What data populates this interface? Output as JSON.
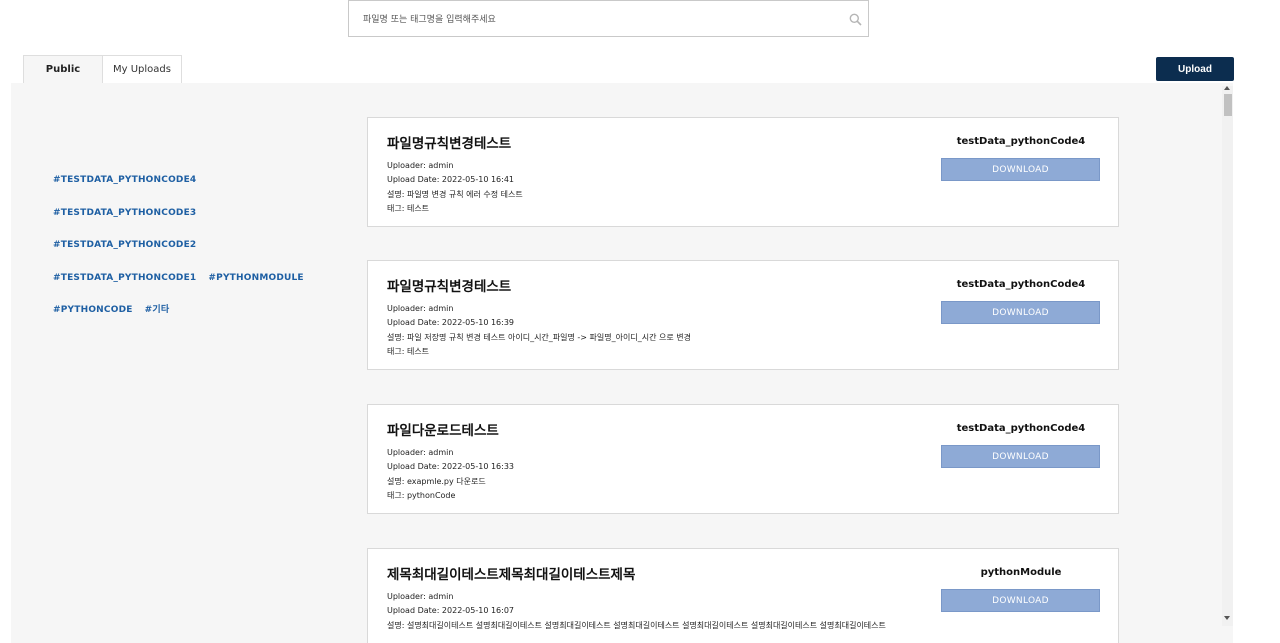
{
  "search": {
    "placeholder": "파일명 또는 태그명을 입력해주세요",
    "value": ""
  },
  "tabs": [
    {
      "label": "Public"
    },
    {
      "label": "My Uploads"
    }
  ],
  "upload_label": "Upload",
  "tag_lines": [
    [
      "#TESTDATA_PYTHONCODE4"
    ],
    [
      "#TESTDATA_PYTHONCODE3"
    ],
    [
      "#TESTDATA_PYTHONCODE2"
    ],
    [
      "#TESTDATA_PYTHONCODE1",
      "#PYTHONMODULE"
    ],
    [
      "#PYTHONCODE",
      "#기타"
    ]
  ],
  "cards": [
    {
      "title": "파일명규칙변경테스트",
      "uploader": "Uploader: admin",
      "date": "Upload Date: 2022-05-10 16:41",
      "desc": "설명: 파일명 변경 규칙 에러 수정 테스트",
      "tags": "태그: 테스트",
      "tag_name": "testData_pythonCode4",
      "download": "DOWNLOAD"
    },
    {
      "title": "파일명규칙변경테스트",
      "uploader": "Uploader: admin",
      "date": "Upload Date: 2022-05-10 16:39",
      "desc": "설명: 파일 저장명 규칙 변경 테스트 아이디_시간_파일명 -> 파일명_아이디_시간 으로 변경",
      "tags": "태그: 테스트",
      "tag_name": "testData_pythonCode4",
      "download": "DOWNLOAD"
    },
    {
      "title": "파일다운로드테스트",
      "uploader": "Uploader: admin",
      "date": "Upload Date: 2022-05-10 16:33",
      "desc": "설명: exapmle.py 다운로드",
      "tags": "태그: pythonCode",
      "tag_name": "testData_pythonCode4",
      "download": "DOWNLOAD"
    },
    {
      "title": "제목최대길이테스트제목최대길이테스트제목",
      "uploader": "Uploader: admin",
      "date": "Upload Date: 2022-05-10 16:07",
      "desc": "설명: 설명최대길이테스트 설명최대길이테스트 설명최대길이테스트 설명최대길이테스트 설명최대길이테스트 설명최대길이테스트 설명최대길이테스트",
      "tags": "",
      "tag_name": "pythonModule",
      "download": "DOWNLOAD"
    }
  ]
}
